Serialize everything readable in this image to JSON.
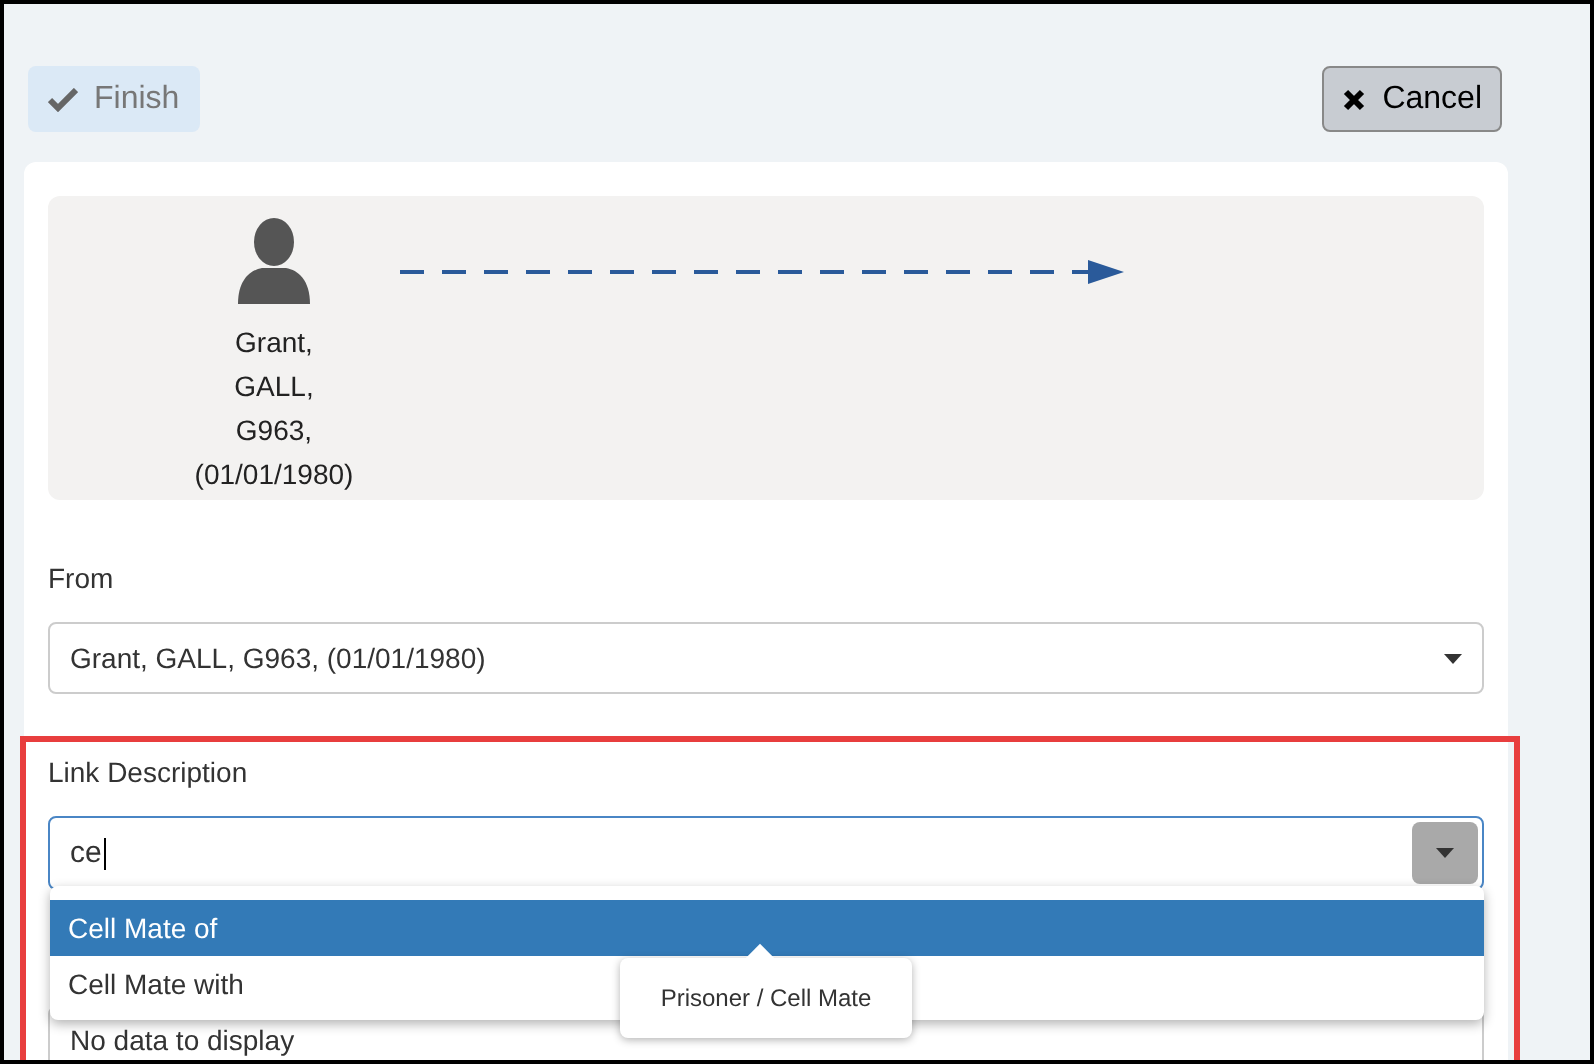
{
  "toolbar": {
    "finish": {
      "label": "Finish",
      "disabled": true
    },
    "cancel": {
      "label": "Cancel"
    }
  },
  "diagram": {
    "person": [
      "Grant,",
      "GALL,",
      "G963,",
      "(01/01/1980)"
    ]
  },
  "from": {
    "label": "From",
    "value": "Grant, GALL, G963, (01/01/1980)"
  },
  "link_description": {
    "label": "Link Description",
    "value": "ce",
    "highlighted": true,
    "options": [
      {
        "label": "Cell Mate of",
        "selected": true
      },
      {
        "label": "Cell Mate with",
        "selected": false
      }
    ]
  },
  "results": {
    "message": "No data to display"
  },
  "tooltip": {
    "text": "Prisoner / Cell Mate"
  }
}
